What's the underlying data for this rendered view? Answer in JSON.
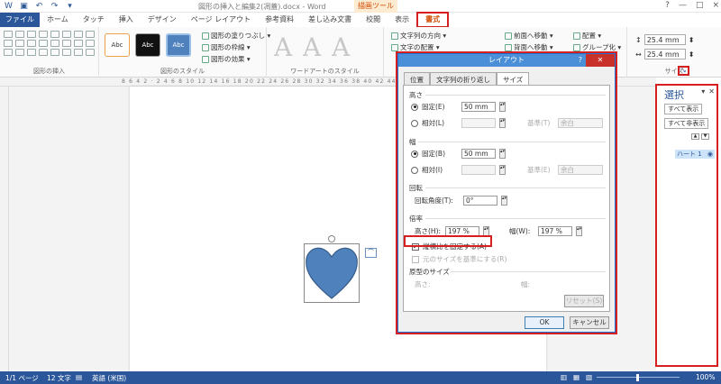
{
  "titlebar": {
    "document_title": "図形の挿入と編集2(凋蓋).docx - Word",
    "context_tools": "描画ツール",
    "window_controls": [
      "?",
      "—",
      "□",
      "×"
    ]
  },
  "tabs": [
    "ファイル",
    "ホーム",
    "タッチ",
    "挿入",
    "デザイン",
    "ページ レイアウト",
    "参考資料",
    "差し込み文書",
    "校閲",
    "表示",
    "書式"
  ],
  "ribbon": {
    "groups": {
      "insert_shapes": "図形の挿入",
      "shape_styles": "図形のスタイル",
      "wordart_styles": "ワードアートのスタイル",
      "size": "サイズ"
    },
    "style_samples": [
      "Abc",
      "Abc",
      "Abc"
    ],
    "shape_fill": "図形の塗りつぶし ▾",
    "shape_outline": "図形の枠線 ▾",
    "shape_effects": "図形の効果 ▾",
    "wordart_letters": [
      "A",
      "A",
      "A"
    ],
    "text_direction": "文字列の方向 ▾",
    "text_align": "文字の配置 ▾",
    "bring_forward": "前面へ移動 ▾",
    "send_backward": "背面へ移動 ▾",
    "align": "配置 ▾",
    "group": "グループ化 ▾",
    "height_value": "25.4 mm",
    "width_value": "25.4 mm",
    "launcher": "↘"
  },
  "ruler": {
    "numbers": "8 6 4 2 · 2 4 6 8 10 12 14 16 18 20 22 24 26 28 30 32 34 36 38 40 42 44 46 48"
  },
  "dialog": {
    "title": "レイアウト",
    "help": "?",
    "close": "✕",
    "tabs": [
      "位置",
      "文字列の折り返し",
      "サイズ"
    ],
    "height_section": "高さ",
    "fixed_label": "固定(E)",
    "fixed_value": "50 mm",
    "relative_label": "相対(L)",
    "base_label_h": "基準(T)",
    "base_value_h": "余白",
    "width_section": "幅",
    "width_fixed_label": "固定(B)",
    "width_fixed_value": "50 mm",
    "width_relative_label": "相対(I)",
    "base_label_w": "基準(E)",
    "base_value_w": "余白",
    "rotation_section": "回転",
    "rotation_label": "回転角度(T):",
    "rotation_value": "0°",
    "scale_section": "倍率",
    "scale_h_label": "高さ(H):",
    "scale_h_value": "197 %",
    "scale_w_label": "幅(W):",
    "scale_w_value": "197 %",
    "lock_aspect": "縦横比を固定する(A)",
    "relative_original": "元のサイズを基準にする(R)",
    "original_section": "原型のサイズ",
    "orig_h_label": "高さ:",
    "orig_w_label": "幅:",
    "reset": "リセット(S)",
    "ok": "OK",
    "cancel": "キャンセル"
  },
  "status": {
    "page": "1/1 ページ",
    "words": "12 文字",
    "language": "英語 (米国)",
    "zoom": "100%"
  },
  "pane": {
    "title": "選択",
    "show_all": "すべて表示",
    "hide_all": "すべて非表示",
    "item": "ハート 1"
  },
  "colors": {
    "brand": "#2b579a",
    "heart": "#4f81bd",
    "highlight": "#d42020",
    "accent_orange": "#d04a02"
  }
}
